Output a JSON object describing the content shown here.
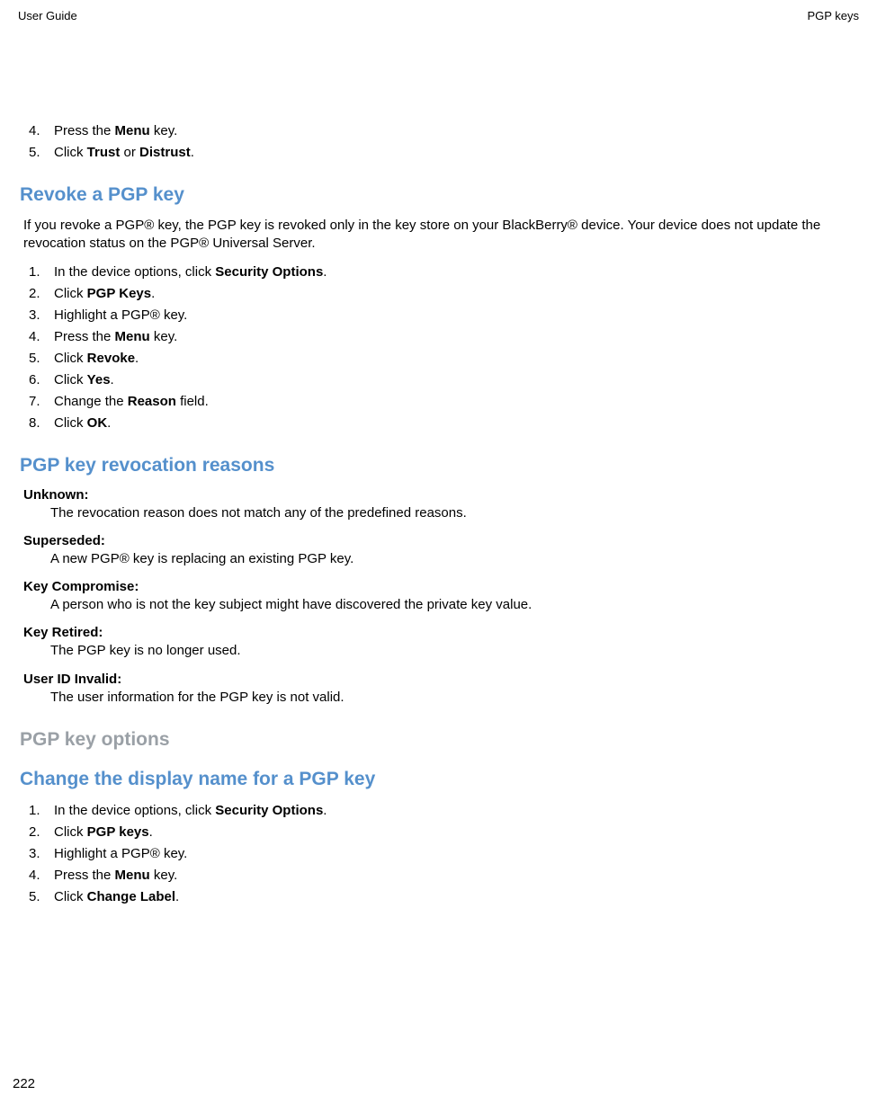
{
  "header": {
    "left": "User Guide",
    "right": "PGP keys"
  },
  "introList": {
    "items": [
      {
        "num": "4.",
        "prefix": "Press the ",
        "bold": "Menu",
        "suffix": " key."
      },
      {
        "num": "5.",
        "prefix": "Click ",
        "bold": "Trust",
        "mid": " or ",
        "bold2": "Distrust",
        "suffix": "."
      }
    ]
  },
  "section1": {
    "title": "Revoke a PGP key",
    "para": "If you revoke a PGP® key, the PGP key is revoked only in the key store on your BlackBerry® device. Your device does not update the revocation status on the PGP® Universal Server.",
    "items": [
      {
        "num": "1.",
        "prefix": "In the device options, click ",
        "bold": "Security Options",
        "suffix": "."
      },
      {
        "num": "2.",
        "prefix": "Click ",
        "bold": "PGP Keys",
        "suffix": "."
      },
      {
        "num": "3.",
        "prefix": "Highlight a PGP® key.",
        "bold": "",
        "suffix": ""
      },
      {
        "num": "4.",
        "prefix": "Press the ",
        "bold": "Menu",
        "suffix": " key."
      },
      {
        "num": "5.",
        "prefix": "Click ",
        "bold": "Revoke",
        "suffix": "."
      },
      {
        "num": "6.",
        "prefix": "Click ",
        "bold": "Yes",
        "suffix": "."
      },
      {
        "num": "7.",
        "prefix": "Change the ",
        "bold": "Reason",
        "suffix": " field."
      },
      {
        "num": "8.",
        "prefix": "Click ",
        "bold": "OK",
        "suffix": "."
      }
    ]
  },
  "section2": {
    "title": "PGP key revocation reasons",
    "reasons": [
      {
        "term": "Unknown",
        "def": "The revocation reason does not match any of the predefined reasons."
      },
      {
        "term": "Superseded",
        "def": "A new PGP® key is replacing an existing PGP key."
      },
      {
        "term": "Key Compromise",
        "def": "A person who is not the key subject might have discovered the private key value."
      },
      {
        "term": "Key Retired",
        "def": "The PGP key is no longer used."
      },
      {
        "term": "User ID Invalid",
        "def": "The user information for the PGP key is not valid."
      }
    ]
  },
  "section3": {
    "title": "PGP key options"
  },
  "section4": {
    "title": "Change the display name for a PGP key",
    "items": [
      {
        "num": "1.",
        "prefix": "In the device options, click ",
        "bold": "Security Options",
        "suffix": "."
      },
      {
        "num": "2.",
        "prefix": "Click ",
        "bold": "PGP keys",
        "suffix": "."
      },
      {
        "num": "3.",
        "prefix": "Highlight a PGP® key.",
        "bold": "",
        "suffix": ""
      },
      {
        "num": "4.",
        "prefix": "Press the ",
        "bold": "Menu",
        "suffix": " key."
      },
      {
        "num": "5.",
        "prefix": "Click ",
        "bold": "Change Label",
        "suffix": "."
      }
    ]
  },
  "pageNumber": "222"
}
